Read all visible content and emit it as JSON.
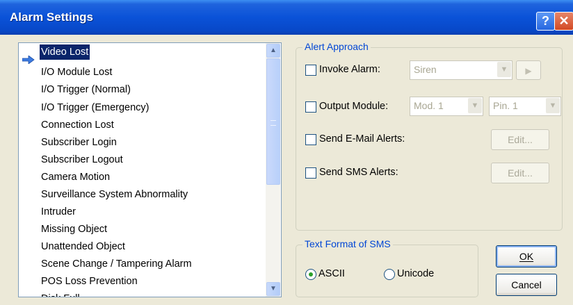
{
  "window": {
    "title": "Alarm Settings",
    "help_glyph": "?",
    "close_glyph": "✕"
  },
  "alarm_list": {
    "items": [
      "Video Lost",
      "I/O Module Lost",
      "I/O Trigger (Normal)",
      "I/O Trigger (Emergency)",
      "Connection Lost",
      "Subscriber Login",
      "Subscriber Logout",
      "Camera Motion",
      "Surveillance System Abnormality",
      "Intruder",
      "Missing Object",
      "Unattended Object",
      "Scene Change / Tampering Alarm",
      "POS Loss Prevention",
      "Disk Full"
    ],
    "selected": "Video Lost"
  },
  "alert_approach": {
    "title": "Alert Approach",
    "invoke_alarm": {
      "label": "Invoke Alarm:",
      "checked": false,
      "value": "Siren",
      "play_glyph": "▶"
    },
    "output_module": {
      "label": "Output Module:",
      "checked": false,
      "module": "Mod. 1",
      "pin": "Pin. 1"
    },
    "email": {
      "label": "Send E-Mail Alerts:",
      "checked": false,
      "edit_label": "Edit..."
    },
    "sms": {
      "label": "Send SMS Alerts:",
      "checked": false,
      "edit_label": "Edit..."
    }
  },
  "sms_format": {
    "title": "Text Format of SMS",
    "options": [
      "ASCII",
      "Unicode"
    ],
    "selected": "ASCII"
  },
  "buttons": {
    "ok": "OK",
    "cancel": "Cancel"
  },
  "colors": {
    "title_bar": "#0a52d8",
    "group_title": "#0046d5",
    "selection": "#0a246a",
    "radio_dot": "#2aa02a"
  }
}
